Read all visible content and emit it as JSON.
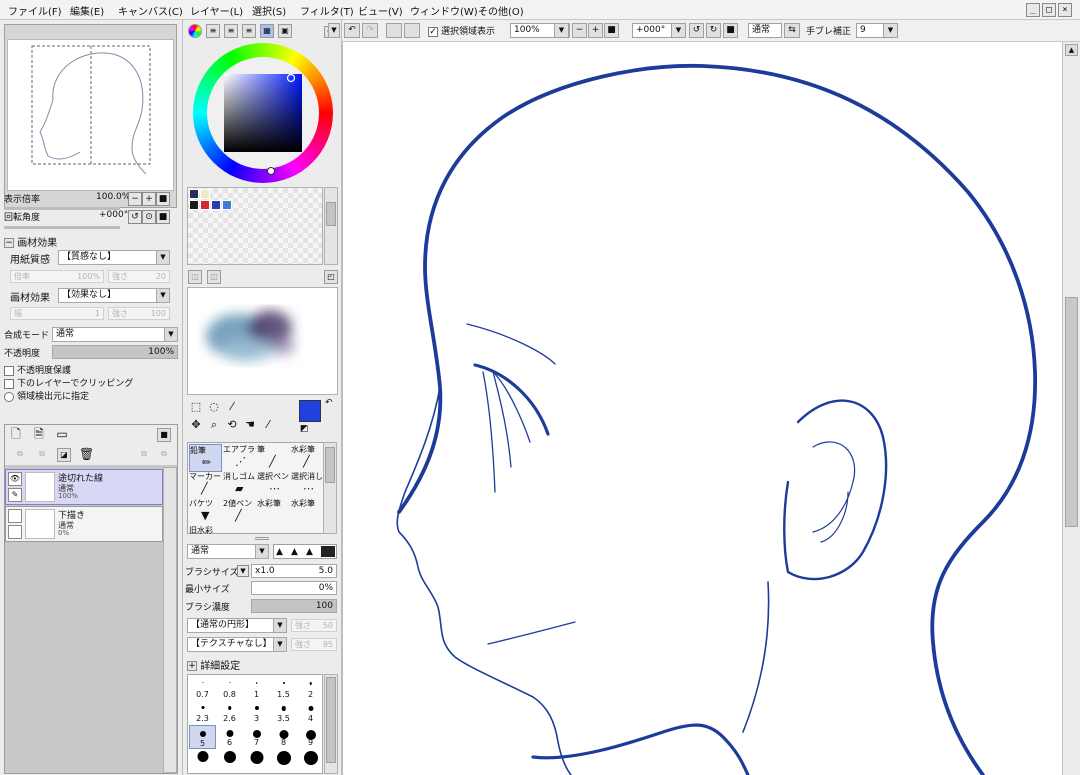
{
  "menu": [
    "ファイル(F)",
    "編集(E)",
    "キャンバス(C)",
    "レイヤー(L)",
    "選択(S)",
    "フィルタ(T)",
    "ビュー(V)",
    "ウィンドウ(W)",
    "その他(O)"
  ],
  "window_controls": [
    "_",
    "□",
    "×"
  ],
  "navigator": {
    "zoom_label": "表示倍率",
    "zoom_value": "100.0%",
    "rotate_label": "回転角度",
    "rotate_value": "+000°"
  },
  "texture": {
    "section_title": "画材効果",
    "paper_label": "用紙質感",
    "paper_value": "【質感なし】",
    "paper_ghost_left": "倍率",
    "paper_ghost_left_val": "100%",
    "paper_ghost_right": "強さ",
    "paper_ghost_right_val": "20",
    "effect_label": "画材効果",
    "effect_value": "【効果なし】",
    "effect_ghost_left": "幅",
    "effect_ghost_left_val": "1",
    "effect_ghost_right": "強さ",
    "effect_ghost_right_val": "100"
  },
  "layer_props": {
    "blend_label": "合成モード",
    "blend_value": "通常",
    "opacity_label": "不透明度",
    "opacity_value": "100%",
    "protect_label": "不透明度保護",
    "clip_label": "下のレイヤーでクリッピング",
    "select_label": "領域検出元に指定"
  },
  "layers": [
    {
      "name": "途切れた線",
      "mode": "通常",
      "opacity": "100%",
      "selected": true
    },
    {
      "name": "下描き",
      "mode": "通常",
      "opacity": "0%",
      "selected": false
    }
  ],
  "colors": {
    "accent": "#2040e0",
    "stroke": "#1d3c9a",
    "swatches": [
      "#2a2e5a",
      "#f3e8c8",
      "#1a1a1a",
      "#d22a2a",
      "#2a3ea8",
      "#3f7fd0"
    ]
  },
  "tools": {
    "cells": [
      {
        "label": "鉛筆",
        "icon": "pencil-icon",
        "glyph": "✏",
        "selected": true
      },
      {
        "label": "エアブラシ",
        "icon": "airbrush-icon",
        "glyph": "⋰",
        "selected": false
      },
      {
        "label": "筆",
        "icon": "brush-icon",
        "glyph": "╱",
        "selected": false
      },
      {
        "label": "水彩筆",
        "icon": "watercolor-icon",
        "glyph": "╱",
        "selected": false
      },
      {
        "label": "マーカー",
        "icon": "marker-icon",
        "glyph": "╱",
        "selected": false
      },
      {
        "label": "消しゴム",
        "icon": "eraser-icon",
        "glyph": "▰",
        "selected": false
      },
      {
        "label": "選択ペン",
        "icon": "select-pen-icon",
        "glyph": "⋯",
        "selected": false
      },
      {
        "label": "選択消し",
        "icon": "select-erase-icon",
        "glyph": "⋯",
        "selected": false
      },
      {
        "label": "バケツ",
        "icon": "bucket-icon",
        "glyph": "▼",
        "selected": false
      },
      {
        "label": "2値ペン",
        "icon": "binary-pen-icon",
        "glyph": "╱",
        "selected": false
      },
      {
        "label": "水彩筆",
        "icon": "watercolor2-icon",
        "glyph": "",
        "selected": false
      },
      {
        "label": "水彩筆",
        "icon": "watercolor3-icon",
        "glyph": "",
        "selected": false
      },
      {
        "label": "旧水彩",
        "icon": "old-watercolor-icon",
        "glyph": "",
        "selected": false
      }
    ],
    "blend_value": "通常",
    "brush_size_label": "ブラシサイズ",
    "brush_size_mult": "x1.0",
    "brush_size_value": "5.0",
    "min_size_label": "最小サイズ",
    "min_size_value": "0%",
    "density_label": "ブラシ濃度",
    "density_value": "100",
    "shape_value": "【通常の円形】",
    "shape_ghost": "強さ",
    "shape_ghost_val": "50",
    "tex_value": "【テクスチャなし】",
    "tex_ghost": "強さ",
    "tex_ghost_val": "95",
    "detail_label": "詳細設定"
  },
  "brush_sizes": [
    "0.7",
    "0.8",
    "1",
    "1.5",
    "2",
    "2.3",
    "2.6",
    "3",
    "3.5",
    "4",
    "5",
    "6",
    "7",
    "8",
    "9",
    "",
    "",
    "",
    "",
    ""
  ],
  "brush_selected_index": 10,
  "canvasbar": {
    "sel_show_label": "選択領域表示",
    "zoom_value": "100%",
    "angle_value": "+000°",
    "mode_value": "通常",
    "stab_label": "手ブレ補正",
    "stab_value": "9"
  }
}
